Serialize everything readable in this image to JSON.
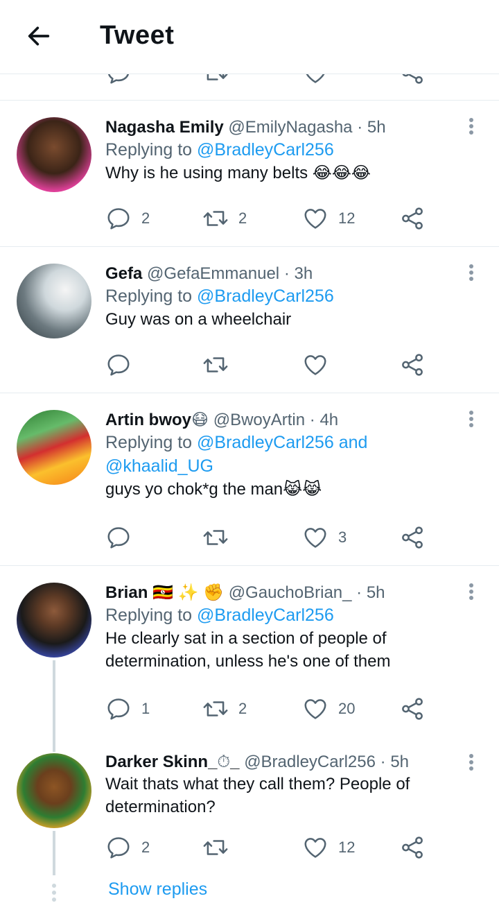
{
  "header": {
    "title": "Tweet"
  },
  "tweets": [
    {
      "name": "Nagasha Emily",
      "handle": "@EmilyNagasha",
      "time": "· 5h",
      "replying_label": "Replying to",
      "replying_to": "@BradleyCarl256",
      "text": "Why is he using many belts",
      "emoji": "😂😂😂",
      "replies": "2",
      "retweets": "2",
      "likes": "12"
    },
    {
      "name": "Gefa",
      "handle": "@GefaEmmanuel",
      "time": "· 3h",
      "replying_label": "Replying to",
      "replying_to": "@BradleyCarl256",
      "text": "Guy was on a wheelchair",
      "replies": "",
      "retweets": "",
      "likes": ""
    },
    {
      "name": "Artin bwoy",
      "name_emoji": "😷",
      "handle": "@BwoyArtin",
      "time": "· 4h",
      "replying_label": "Replying to",
      "replying_to": "@BradleyCarl256",
      "replying_and": "and",
      "replying_to_2": "@khaalid_UG",
      "text": "guys yo chok*g the man",
      "emoji": "😹😹",
      "replies": "",
      "retweets": "",
      "likes": "3"
    },
    {
      "name": "Brian",
      "name_emoji": "🇺🇬 ✨ ✊",
      "handle": "@GauchoBrian_",
      "time": "· 5h",
      "replying_label": "Replying to",
      "replying_to": "@BradleyCarl256",
      "text": "He clearly sat in a section of people of determination, unless he's one of them",
      "replies": "1",
      "retweets": "2",
      "likes": "20"
    },
    {
      "name": "Darker Skinn_",
      "name_emoji": "⏱",
      "name_suffix": "_",
      "handle": "@BradleyCarl256",
      "time": "· 5h",
      "text": "Wait thats what they call them? People of determination?",
      "replies": "2",
      "retweets": "",
      "likes": "12"
    }
  ],
  "show_replies": "Show replies",
  "icons": [
    "back-arrow-icon",
    "more-icon",
    "reply-icon",
    "retweet-icon",
    "like-icon",
    "share-icon"
  ],
  "colors": {
    "accent": "#1d9bf0",
    "secondary_text": "#536471",
    "divider": "#e6ecf0"
  }
}
